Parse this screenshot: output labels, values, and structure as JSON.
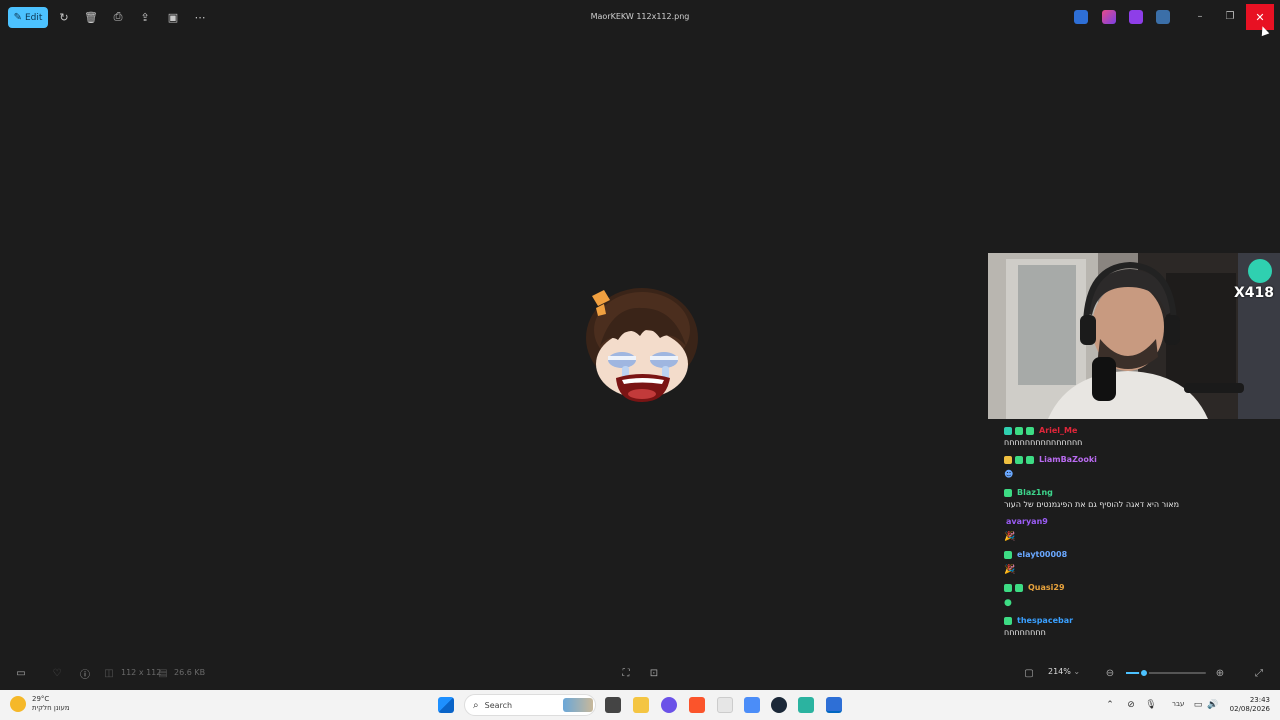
{
  "titlebar": {
    "edit_label": "Edit",
    "title": "MaorKEKW 112x112.png"
  },
  "viewer": {
    "dimensions": "112 x 112",
    "file_size": "26.6 KB",
    "zoom": "214%",
    "zoom_slider_fraction": 0.23
  },
  "webcam": {
    "badge": "X418"
  },
  "chat": {
    "messages": [
      {
        "user": "Ariel_Me",
        "color": "#e0263a",
        "text": "חחחחחחחחחחחחחחח"
      },
      {
        "user": "LiamBaZooki",
        "color": "#b96bf0",
        "emote": "☻"
      },
      {
        "user": "Blaz1ng",
        "color": "#3dd68c",
        "text": "מאור היא דאגה להוסיף גם את הפיגמנטים של העור"
      },
      {
        "user": "avaryan9",
        "color": "#9b5cf5",
        "emote": "🎉"
      },
      {
        "user": "elayt00008",
        "color": "#6aa8ff",
        "emote": "🎉"
      },
      {
        "user": "Quasi29",
        "color": "#e8a33d",
        "emote": "●"
      },
      {
        "user": "thespacebar",
        "color": "#3aa0ff",
        "text": "חחחחחחחח"
      }
    ]
  },
  "taskbar": {
    "weather_temp": "29°C",
    "weather_desc": "מעונן חלקית",
    "search_label": "Search",
    "language": "עבר",
    "time": "23:43",
    "date": "02/08/2026"
  },
  "colors": {
    "accent": "#4cc2ff",
    "close_red": "#e81123"
  }
}
